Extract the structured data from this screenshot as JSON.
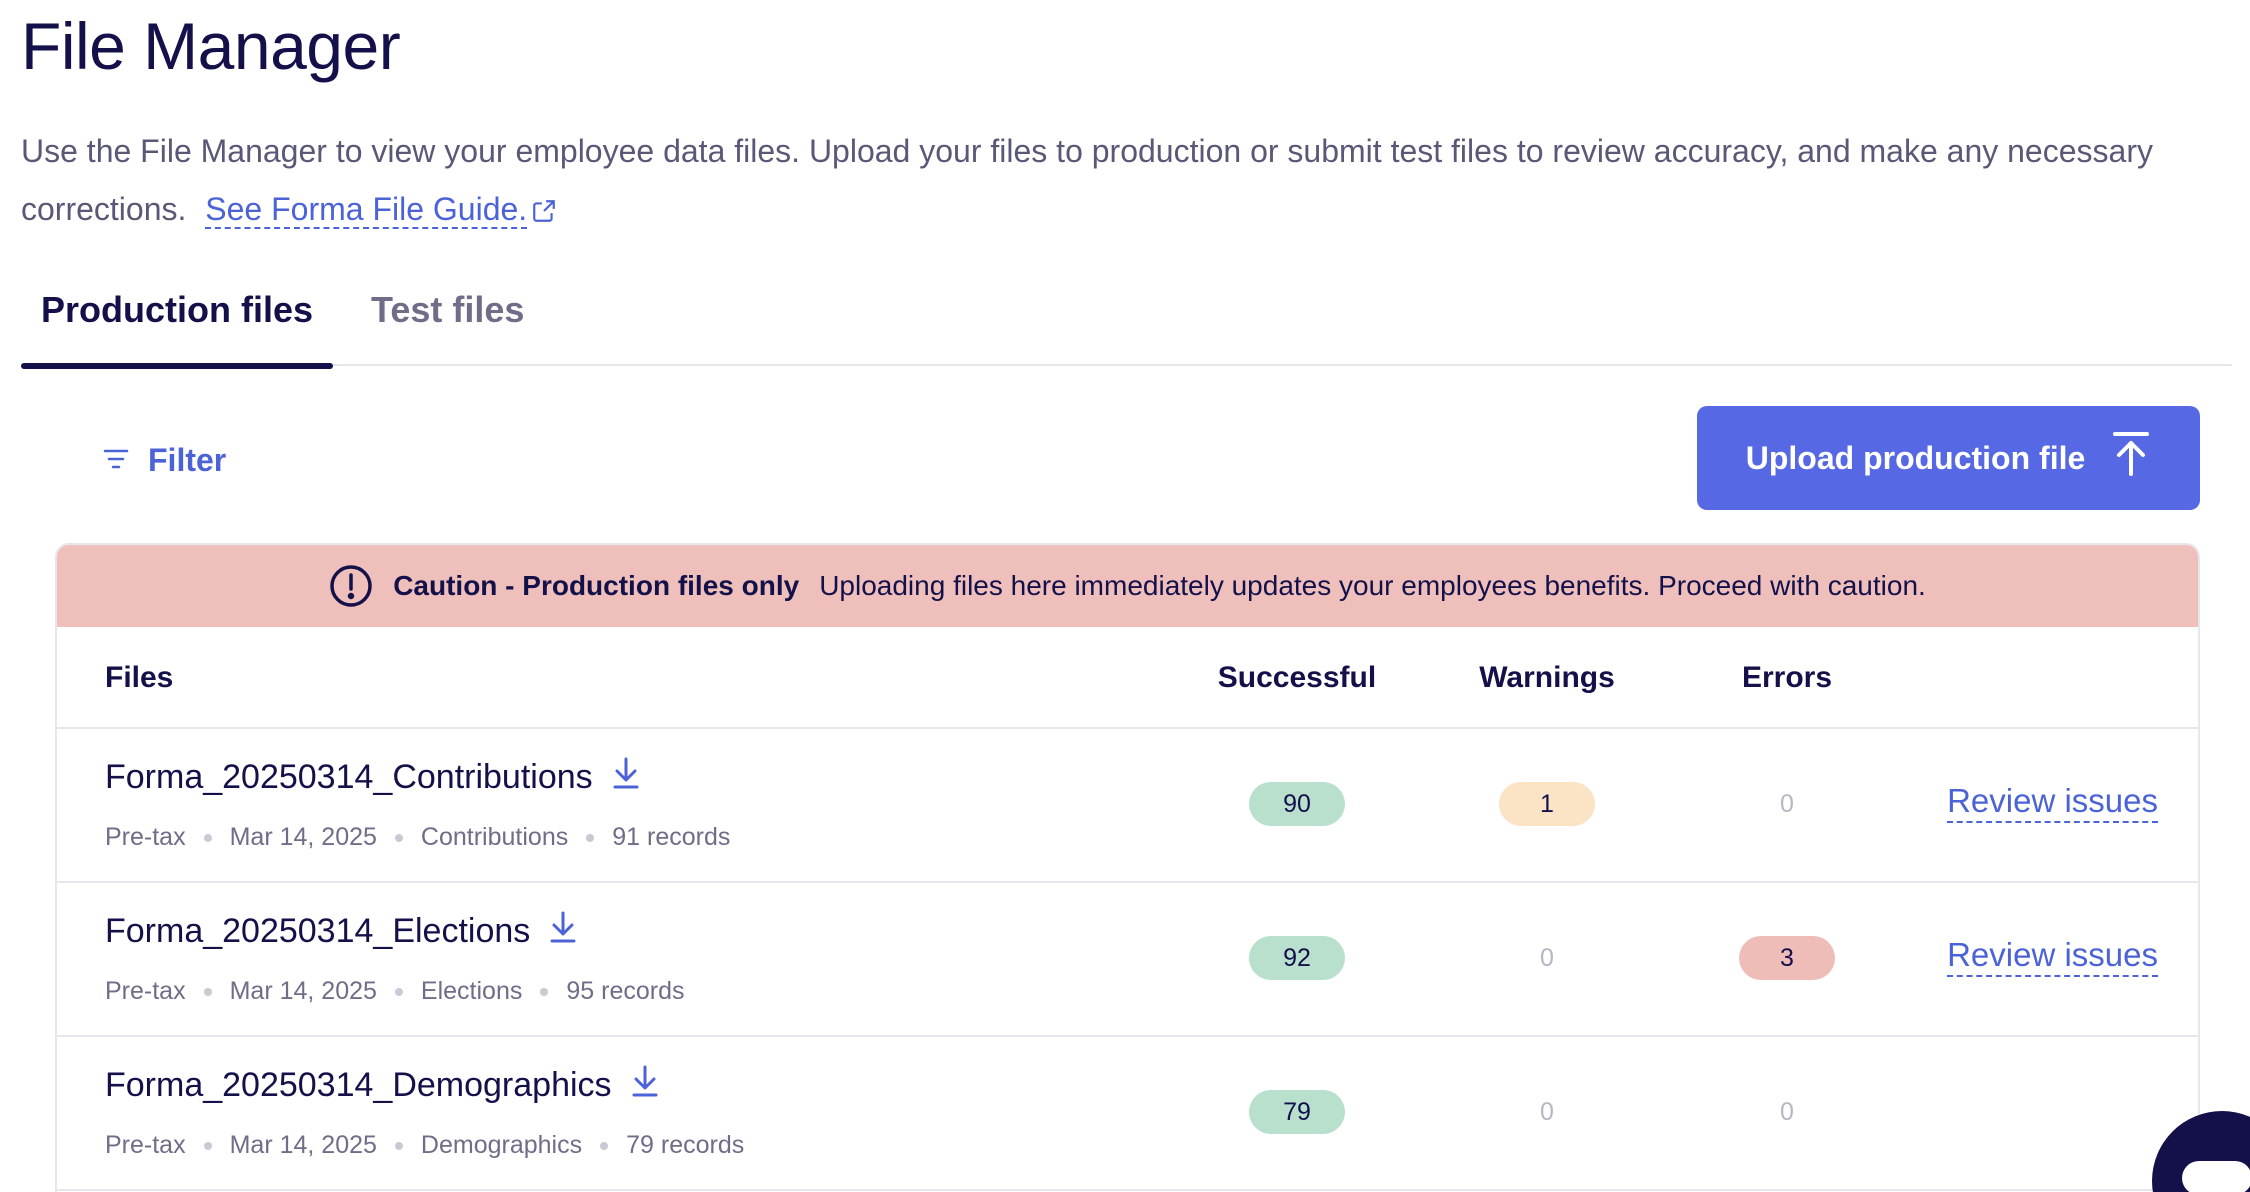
{
  "header": {
    "title": "File Manager",
    "description": "Use the File Manager to view your employee data files. Upload your files to production or submit test files to review accuracy, and make any necessary corrections.",
    "guide_link": "See Forma File Guide."
  },
  "tabs": [
    {
      "label": "Production files",
      "active": true
    },
    {
      "label": "Test files",
      "active": false
    }
  ],
  "toolbar": {
    "filter_label": "Filter",
    "upload_label": "Upload production file"
  },
  "caution": {
    "title": "Caution - Production files only",
    "message": "Uploading files here immediately updates your employees benefits. Proceed with caution."
  },
  "table": {
    "headers": {
      "files": "Files",
      "successful": "Successful",
      "warnings": "Warnings",
      "errors": "Errors"
    },
    "rows": [
      {
        "name": "Forma_20250314_Contributions",
        "type": "Pre-tax",
        "date": "Mar 14, 2025",
        "category": "Contributions",
        "records": "91 records",
        "successful": "90",
        "warnings": "1",
        "errors": "0",
        "action": "Review issues"
      },
      {
        "name": "Forma_20250314_Elections",
        "type": "Pre-tax",
        "date": "Mar 14, 2025",
        "category": "Elections",
        "records": "95 records",
        "successful": "92",
        "warnings": "0",
        "errors": "3",
        "action": "Review issues"
      },
      {
        "name": "Forma_20250314_Demographics",
        "type": "Pre-tax",
        "date": "Mar 14, 2025",
        "category": "Demographics",
        "records": "79 records",
        "successful": "79",
        "warnings": "0",
        "errors": "0",
        "action": ""
      }
    ]
  },
  "colors": {
    "brand": "#5668e3",
    "link": "#4c63d8",
    "navy": "#13104a",
    "caution_bg": "#efbfbb",
    "success_pill": "#b8e0cd",
    "warning_pill": "#fbe3c6",
    "error_pill": "#efbdb8"
  }
}
